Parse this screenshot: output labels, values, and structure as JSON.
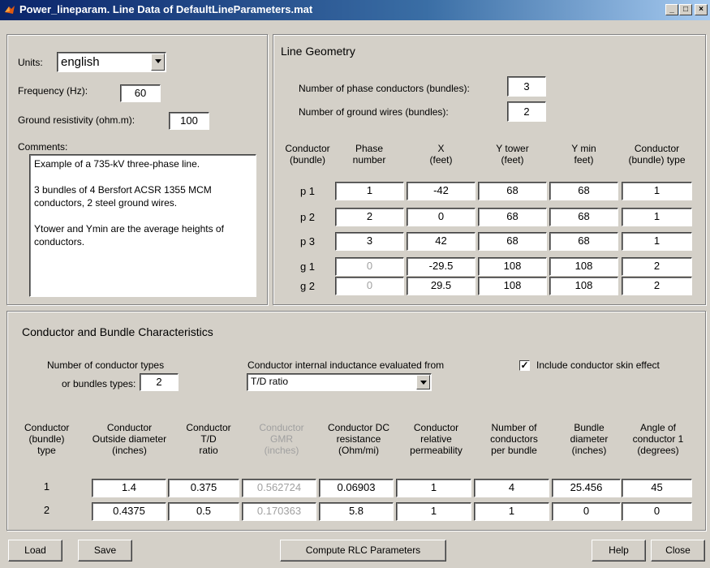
{
  "window": {
    "title": "Power_lineparam. Line Data of DefaultLineParameters.mat",
    "controls": {
      "minimize": "_",
      "maximize": "□",
      "close": "×"
    }
  },
  "general": {
    "units_label": "Units:",
    "units_value": "english",
    "frequency_label": "Frequency (Hz):",
    "frequency_value": "60",
    "ground_label": "Ground resistivity (ohm.m):",
    "ground_value": "100",
    "comments_label": "Comments:",
    "comments_text": "Example of a 735-kV three-phase line.\n\n3 bundles of 4 Bersfort ACSR 1355 MCM conductors, 2 steel ground wires.\n\nYtower and Ymin are the average heights of conductors."
  },
  "geometry": {
    "title": "Line Geometry",
    "phase_label": "Number of phase conductors (bundles):",
    "phase_value": "3",
    "ground_label": "Number of ground wires (bundles):",
    "ground_value": "2",
    "headers": [
      [
        "Conductor",
        "(bundle)"
      ],
      [
        "Phase",
        "number"
      ],
      [
        "X",
        "(feet)"
      ],
      [
        "Y tower",
        "(feet)"
      ],
      [
        "Y min",
        "feet)"
      ],
      [
        "Conductor",
        "(bundle) type"
      ]
    ],
    "rows": [
      {
        "label": "p 1",
        "cells": [
          "1",
          "-42",
          "68",
          "68",
          "1"
        ]
      },
      {
        "label": "p 2",
        "cells": [
          "2",
          "0",
          "68",
          "68",
          "1"
        ]
      },
      {
        "label": "p 3",
        "cells": [
          "3",
          "42",
          "68",
          "68",
          "1"
        ]
      },
      {
        "label": "g 1",
        "cells": [
          "0",
          "-29.5",
          "108",
          "108",
          "2"
        ]
      },
      {
        "label": "g 2",
        "cells": [
          "0",
          "29.5",
          "108",
          "108",
          "2"
        ]
      }
    ]
  },
  "characteristics": {
    "title": "Conductor and Bundle Characteristics",
    "types_label_1": "Number of conductor types",
    "types_label_2": "or bundles types:",
    "types_value": "2",
    "inductance_label": "Conductor internal inductance evaluated from",
    "inductance_value": "T/D ratio",
    "skin_label": "Include conductor skin effect",
    "skin_checked": "✓",
    "headers": [
      [
        "Conductor",
        "(bundle)",
        "type"
      ],
      [
        "Conductor",
        "Outside diameter",
        "(inches)"
      ],
      [
        "Conductor",
        "T/D",
        "ratio"
      ],
      [
        "Conductor",
        "GMR",
        "(inches)"
      ],
      [
        "Conductor DC",
        "resistance",
        "(Ohm/mi)"
      ],
      [
        "Conductor",
        "relative",
        "permeability"
      ],
      [
        "Number of",
        "conductors",
        "per bundle"
      ],
      [
        "Bundle",
        "diameter",
        "(inches)"
      ],
      [
        "Angle of",
        "conductor 1",
        "(degrees)"
      ]
    ],
    "rows": [
      {
        "label": "1",
        "cells": [
          "1.4",
          "0.375",
          "0.562724",
          "0.06903",
          "1",
          "4",
          "25.456",
          "45"
        ]
      },
      {
        "label": "2",
        "cells": [
          "0.4375",
          "0.5",
          "0.170363",
          "5.8",
          "1",
          "1",
          "0",
          "0"
        ]
      }
    ]
  },
  "buttons": {
    "load": "Load",
    "save": "Save",
    "compute": "Compute RLC Parameters",
    "help": "Help",
    "close": "Close"
  }
}
